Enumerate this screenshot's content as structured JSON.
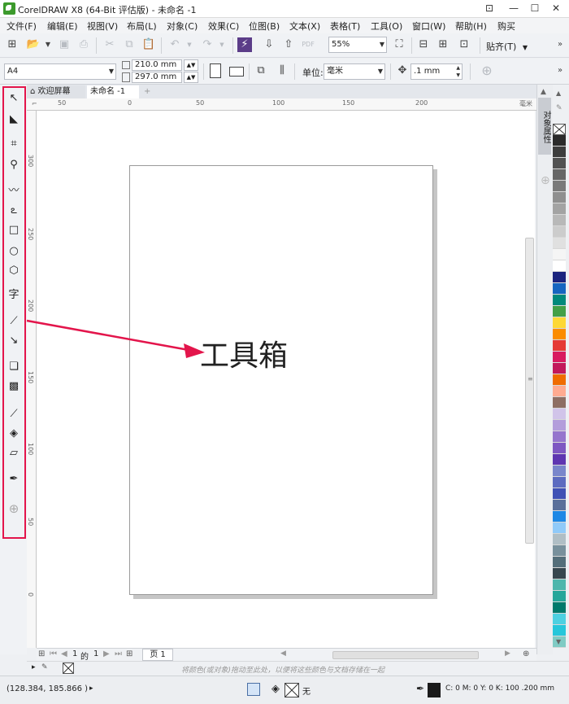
{
  "window": {
    "title": "CorelDRAW X8 (64-Bit 评估版) - 未命名 -1",
    "minimize": "—",
    "maximize": "☐",
    "close": "✕"
  },
  "menu": [
    "文件(F)",
    "编辑(E)",
    "视图(V)",
    "布局(L)",
    "对象(C)",
    "效果(C)",
    "位图(B)",
    "文本(X)",
    "表格(T)",
    "工具(O)",
    "窗口(W)",
    "帮助(H)",
    "购买"
  ],
  "standard_toolbar": {
    "zoom_value": "55%",
    "snap_label": "贴齐(T)"
  },
  "property_bar": {
    "paper_size": "A4",
    "width": "210.0 mm",
    "height": "297.0 mm",
    "units_label": "单位:",
    "units_value": "毫米",
    "nudge_value": ".1 mm"
  },
  "tabs": [
    {
      "label": "欢迎屏幕"
    },
    {
      "label": "未命名 -1"
    }
  ],
  "rulers": {
    "h_labels": [
      "50",
      "0",
      "50",
      "100",
      "150",
      "200"
    ],
    "h_unit": "毫米",
    "v_labels": [
      "300",
      "250",
      "200",
      "150",
      "100",
      "50",
      "0"
    ]
  },
  "toolbox_tools": [
    {
      "name": "pick-tool",
      "glyph": "↖"
    },
    {
      "name": "shape-tool",
      "glyph": "◣"
    },
    {
      "name": "crop-tool",
      "glyph": "⌗"
    },
    {
      "name": "zoom-tool",
      "glyph": "⚲"
    },
    {
      "name": "freehand-tool",
      "glyph": "〰"
    },
    {
      "name": "artistic-media-tool",
      "glyph": "ఽ"
    },
    {
      "name": "rectangle-tool",
      "glyph": "□"
    },
    {
      "name": "ellipse-tool",
      "glyph": "○"
    },
    {
      "name": "polygon-tool",
      "glyph": "⬡"
    },
    {
      "name": "text-tool",
      "glyph": "字"
    },
    {
      "name": "dimension-tool",
      "glyph": "⟋"
    },
    {
      "name": "connector-tool",
      "glyph": "↘"
    },
    {
      "name": "drop-shadow-tool",
      "glyph": "❏"
    },
    {
      "name": "transparency-tool",
      "glyph": "▩"
    },
    {
      "name": "eyedropper-tool",
      "glyph": "⟋"
    },
    {
      "name": "interactive-fill-tool",
      "glyph": "◈"
    },
    {
      "name": "smart-fill-tool",
      "glyph": "▱"
    },
    {
      "name": "outline-pen-tool",
      "glyph": "✒"
    },
    {
      "name": "add-tool",
      "glyph": "⊕"
    }
  ],
  "docker": {
    "label": "对象属性"
  },
  "palette_colors": [
    "#ffffff",
    "#2b2b2b",
    "#3d3d3d",
    "#525252",
    "#666666",
    "#7a7a7a",
    "#8f8f8f",
    "#a3a3a3",
    "#b8b8b8",
    "#cccccc",
    "#e0e0e0",
    "#f5f5f5",
    "#ffffff",
    "#1a237e",
    "#1565c0",
    "#00897b",
    "#43a047",
    "#fdd835",
    "#fb8c00",
    "#e53935",
    "#d81b60",
    "#c2185b",
    "#ef6c00",
    "#ffab91",
    "#8d6e63",
    "#d1c4e9",
    "#b39ddb",
    "#9575cd",
    "#7e57c2",
    "#5e35b1",
    "#7986cb",
    "#5c6bc0",
    "#3f51b5",
    "#5a6f9a",
    "#1e88e5",
    "#90caf9",
    "#b0bec5",
    "#78909c",
    "#546e7a",
    "#37474f",
    "#4db6ac",
    "#26a69a",
    "#00796b",
    "#4dd0e1",
    "#26c6da",
    "#80cbc4"
  ],
  "page_nav": {
    "current": "1",
    "of_label": "的",
    "total": "1",
    "page_tab": "页 1"
  },
  "hint": "将颜色(或对象)拖动至此处，以便将这些颜色与文档存储在一起",
  "status": {
    "coords": "(128.384, 185.866 )",
    "fill_label": "无",
    "outline_value": "C: 0 M: 0 Y: 0 K: 100  .200 mm"
  },
  "annotation": {
    "label": "工具箱"
  }
}
